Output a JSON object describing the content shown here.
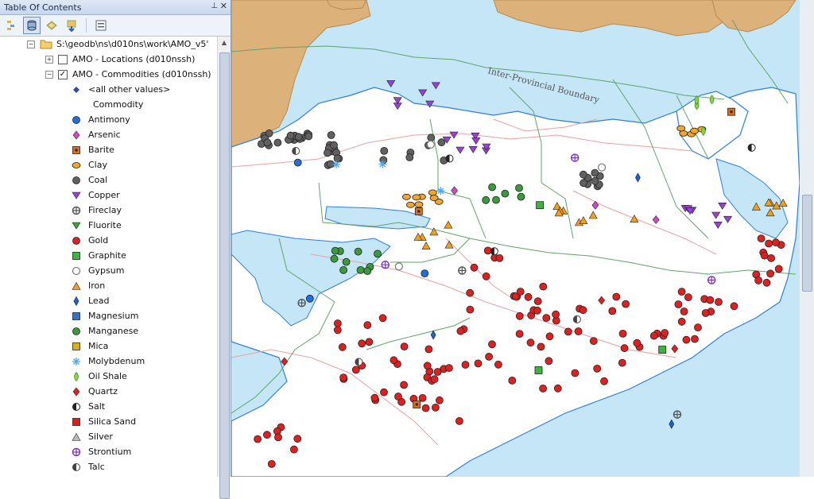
{
  "toc": {
    "title": "Table Of Contents",
    "pin_icon": "pin-icon",
    "close_icon": "close-icon",
    "toolbar": [
      "list-by-drawing-order-icon",
      "list-by-source-icon",
      "list-by-visibility-icon",
      "list-by-selection-icon",
      "options-icon"
    ],
    "workspace": "S:\\geodb\\ns\\d010ns\\work\\AMO_v5'",
    "layers": [
      {
        "label": "AMO - Locations (d010nssh)",
        "checked": false,
        "expanded": false
      },
      {
        "label": "AMO - Commodities (d010nssh)",
        "checked": true,
        "expanded": true
      }
    ],
    "other_values": "<all other values>",
    "field_name": "Commodity",
    "legend": [
      {
        "label": "Antimony",
        "icon": "circle",
        "color": "#1f6fe0"
      },
      {
        "label": "Arsenic",
        "icon": "diamond",
        "color": "#d246c8"
      },
      {
        "label": "Barite",
        "icon": "square-dot",
        "color": "#d9701e"
      },
      {
        "label": "Clay",
        "icon": "ellipse",
        "color": "#f2a72c"
      },
      {
        "label": "Coal",
        "icon": "circle",
        "color": "#606060"
      },
      {
        "label": "Copper",
        "icon": "triangle-down",
        "color": "#9a3fd8"
      },
      {
        "label": "Fireclay",
        "icon": "ring-cross",
        "color": "#555555"
      },
      {
        "label": "Fluorite",
        "icon": "triangle-down",
        "color": "#3aa23a"
      },
      {
        "label": "Gold",
        "icon": "circle",
        "color": "#e02020"
      },
      {
        "label": "Graphite",
        "icon": "square",
        "color": "#3db43d"
      },
      {
        "label": "Gypsum",
        "icon": "ring",
        "color": "#777777"
      },
      {
        "label": "Iron",
        "icon": "triangle-up",
        "color": "#f0a020"
      },
      {
        "label": "Lead",
        "icon": "lead-diamond",
        "color": "#1f5fd0"
      },
      {
        "label": "Magnesium",
        "icon": "square",
        "color": "#3a6fc8"
      },
      {
        "label": "Manganese",
        "icon": "circle",
        "color": "#3c9a3c"
      },
      {
        "label": "Mica",
        "icon": "square",
        "color": "#d8b020"
      },
      {
        "label": "Molybdenum",
        "icon": "asterisk",
        "color": "#50a8e8"
      },
      {
        "label": "Oil Shale",
        "icon": "leaf",
        "color": "#8ad240"
      },
      {
        "label": "Quartz",
        "icon": "diamond",
        "color": "#e02020"
      },
      {
        "label": "Salt",
        "icon": "half-circle",
        "color": "#222222"
      },
      {
        "label": "Silica Sand",
        "icon": "square",
        "color": "#d82020"
      },
      {
        "label": "Silver",
        "icon": "triangle-up",
        "color": "#bbbbbb"
      },
      {
        "label": "Strontium",
        "icon": "ring-cross",
        "color": "#7a3ab8"
      },
      {
        "label": "Talc",
        "icon": "half-circle",
        "color": "#444444"
      }
    ]
  },
  "map": {
    "boundary_label": "Inter-Provincial Boundary",
    "colors": {
      "water": "#c5e6f7",
      "land_white": "#ffffff",
      "land_tan": "#dcb27a",
      "coast": "#2f7fd8",
      "boundary": "#5fa46a",
      "road": "#e8a0a0"
    }
  }
}
